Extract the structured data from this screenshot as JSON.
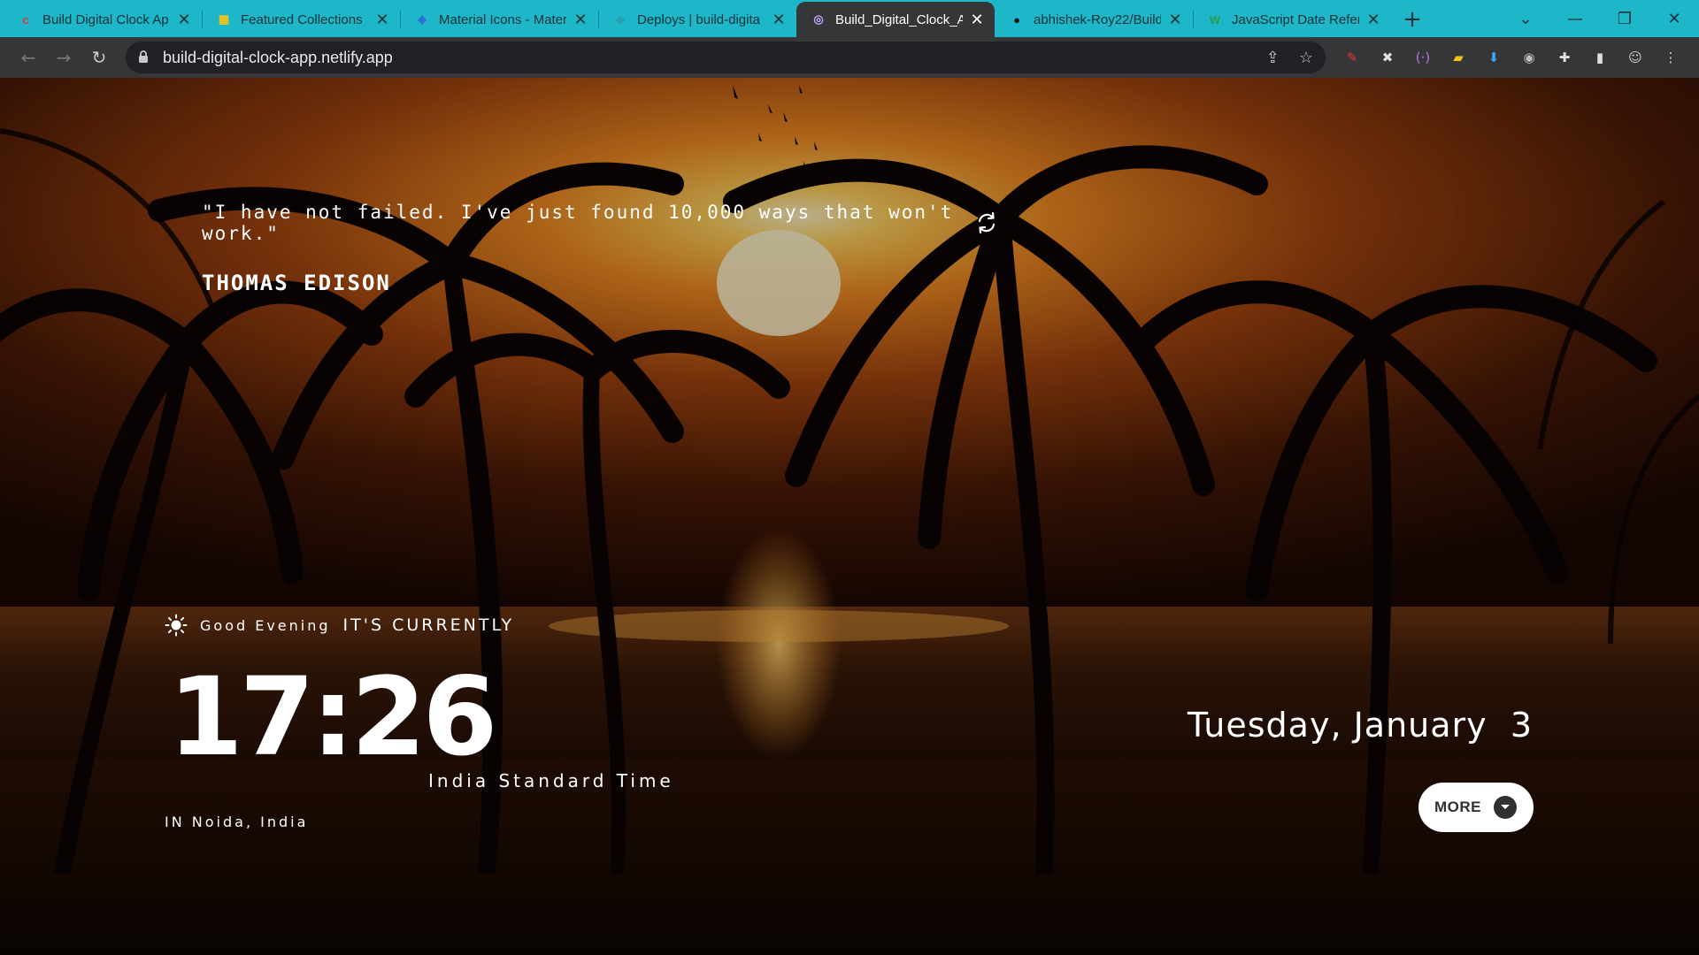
{
  "browser": {
    "tabs": [
      {
        "title": "Build Digital Clock Ap",
        "favicon": "c",
        "favicon_color": "#e03a3a",
        "favicon_bg": "transparent"
      },
      {
        "title": "Featured Collections",
        "favicon": "▦",
        "favicon_color": "#f5c518",
        "favicon_bg": "transparent"
      },
      {
        "title": "Material Icons - Mater",
        "favicon": "◈",
        "favicon_color": "#2f6bd8",
        "favicon_bg": "transparent"
      },
      {
        "title": "Deploys | build-digita",
        "favicon": "◆",
        "favicon_color": "#2a9fb0",
        "favicon_bg": "transparent"
      },
      {
        "title": "Build_Digital_Clock_Ap",
        "favicon": "◎",
        "favicon_color": "#c9a7ff",
        "favicon_bg": "transparent"
      },
      {
        "title": "abhishek-Roy22/Build",
        "favicon": "●",
        "favicon_color": "#111111",
        "favicon_bg": "transparent"
      },
      {
        "title": "JavaScript Date Refere",
        "favicon": "W",
        "favicon_color": "#2b9a4a",
        "favicon_bg": "transparent"
      }
    ],
    "active_tab_index": 4,
    "tab_close_glyph": "✕",
    "new_tab_glyph": "+",
    "window_controls": {
      "dropdown": "⌄",
      "minimize": "—",
      "restore": "❐",
      "close": "✕"
    },
    "nav": {
      "back": "←",
      "forward": "→",
      "reload": "↻"
    },
    "url": "build-digital-clock-app.netlify.app",
    "omnibox_icons": {
      "share": "⇪",
      "star": "☆"
    },
    "extensions": [
      {
        "name": "pen-extension-icon",
        "glyph": "✎",
        "color": "#e53935"
      },
      {
        "name": "x-extension-icon",
        "glyph": "✖",
        "color": "#e0e0e0"
      },
      {
        "name": "bracket-extension-icon",
        "glyph": "(·)",
        "color": "#c06bd8"
      },
      {
        "name": "folder-extension-icon",
        "glyph": "▰",
        "color": "#f4c20d"
      },
      {
        "name": "download-extension-icon",
        "glyph": "⬇",
        "color": "#42a5f5"
      },
      {
        "name": "camera-extension-icon",
        "glyph": "◉",
        "color": "#bdbdbd"
      },
      {
        "name": "puzzle-extension-icon",
        "glyph": "✚",
        "color": "#e0e0e0"
      },
      {
        "name": "sidepanel-icon",
        "glyph": "▮",
        "color": "#e0e0e0"
      },
      {
        "name": "profile-avatar-icon",
        "glyph": "☺",
        "color": "#d0d0d0"
      },
      {
        "name": "menu-kebab-icon",
        "glyph": "⋮",
        "color": "#e0e0e0"
      }
    ]
  },
  "page": {
    "quote": "\"I have not failed. I've just found 10,000 ways that won't work.\"",
    "author": "THOMAS EDISON",
    "greeting": "Good Evening",
    "currently": "IT'S CURRENTLY",
    "time": "17:26",
    "timezone": "India Standard Time",
    "location": "IN Noida, India",
    "date": "Tuesday, January  3",
    "more_label": "MORE"
  }
}
